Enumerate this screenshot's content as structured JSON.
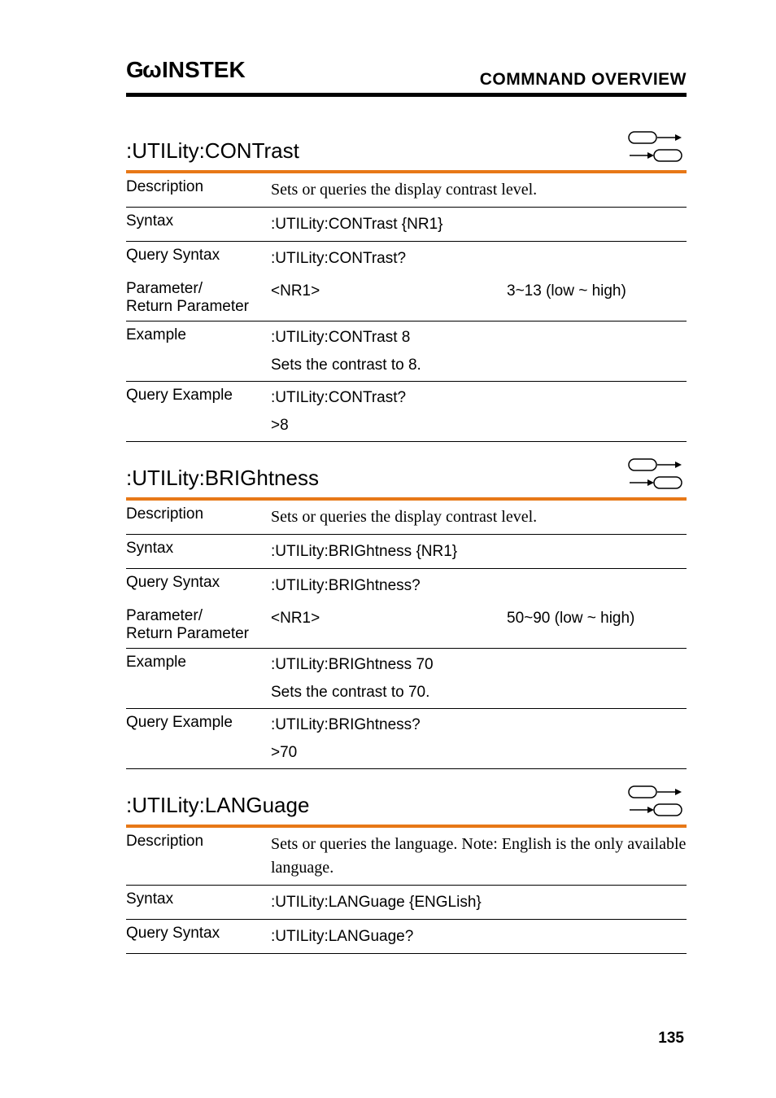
{
  "header": {
    "logo": "GWINSTEK",
    "title": "COMMNAND OVERVIEW"
  },
  "sections": [
    {
      "title": ":UTILity:CONTrast",
      "rows": [
        {
          "label": "Description",
          "type": "serif",
          "text": "Sets or queries the display contrast level."
        },
        {
          "label": "Syntax",
          "type": "sans",
          "text": ":UTILity:CONTrast {NR1}"
        },
        {
          "label": "Query Syntax",
          "type": "sans",
          "text": ":UTILity:CONTrast?",
          "noborder": true
        },
        {
          "label": "Parameter/\nReturn Parameter",
          "type": "param",
          "left": "<NR1>",
          "right": "3~13 (low ~ high)"
        },
        {
          "label": "Example",
          "type": "multi-sans",
          "lines": [
            ":UTILity:CONTrast 8",
            "Sets the contrast to 8."
          ]
        },
        {
          "label": "Query Example",
          "type": "multi-sans",
          "lines": [
            ":UTILity:CONTrast?",
            ">8"
          ]
        }
      ]
    },
    {
      "title": ":UTILity:BRIGhtness",
      "rows": [
        {
          "label": "Description",
          "type": "serif",
          "text": "Sets or queries the display contrast level."
        },
        {
          "label": "Syntax",
          "type": "sans",
          "text": ":UTILity:BRIGhtness {NR1}"
        },
        {
          "label": "Query Syntax",
          "type": "sans",
          "text": ":UTILity:BRIGhtness?",
          "noborder": true
        },
        {
          "label": "Parameter/\nReturn Parameter",
          "type": "param",
          "left": "<NR1>",
          "right": "50~90 (low ~ high)"
        },
        {
          "label": "Example",
          "type": "multi-sans",
          "lines": [
            ":UTILity:BRIGhtness 70",
            "Sets the contrast to 70."
          ]
        },
        {
          "label": "Query Example",
          "type": "multi-sans",
          "lines": [
            ":UTILity:BRIGhtness?",
            ">70"
          ]
        }
      ]
    },
    {
      "title": ":UTILity:LANGuage",
      "rows": [
        {
          "label": "Description",
          "type": "serif",
          "text": "Sets or queries the language. Note: English is the only available language."
        },
        {
          "label": "Syntax",
          "type": "sans",
          "text": ":UTILity:LANGuage {ENGLish}"
        },
        {
          "label": "Query Syntax",
          "type": "sans",
          "text": ":UTILity:LANGuage?"
        }
      ]
    }
  ],
  "pageNumber": "135"
}
